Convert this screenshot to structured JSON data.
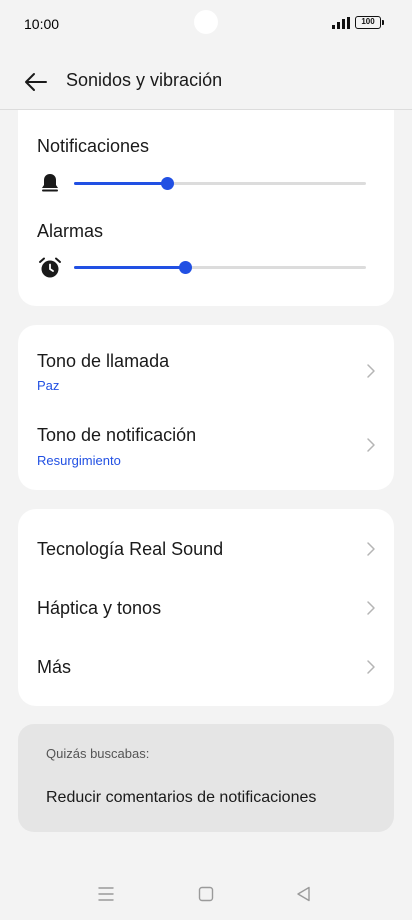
{
  "status_bar": {
    "time": "10:00",
    "battery": "100"
  },
  "header": {
    "title": "Sonidos y vibración"
  },
  "volume": {
    "notifications": {
      "label": "Notificaciones",
      "level": 0.32
    },
    "alarms": {
      "label": "Alarmas",
      "level": 0.38
    }
  },
  "ringtones": [
    {
      "title": "Tono de llamada",
      "value": "Paz"
    },
    {
      "title": "Tono de notificación",
      "value": "Resurgimiento"
    }
  ],
  "settings": [
    {
      "title": "Tecnología Real Sound"
    },
    {
      "title": "Háptica y tonos"
    },
    {
      "title": "Más"
    }
  ],
  "suggestions": {
    "label": "Quizás buscabas:",
    "item": "Reducir comentarios de notificaciones"
  },
  "colors": {
    "accent": "#2150e3",
    "background": "#f3f3f3",
    "card": "#ffffff"
  }
}
